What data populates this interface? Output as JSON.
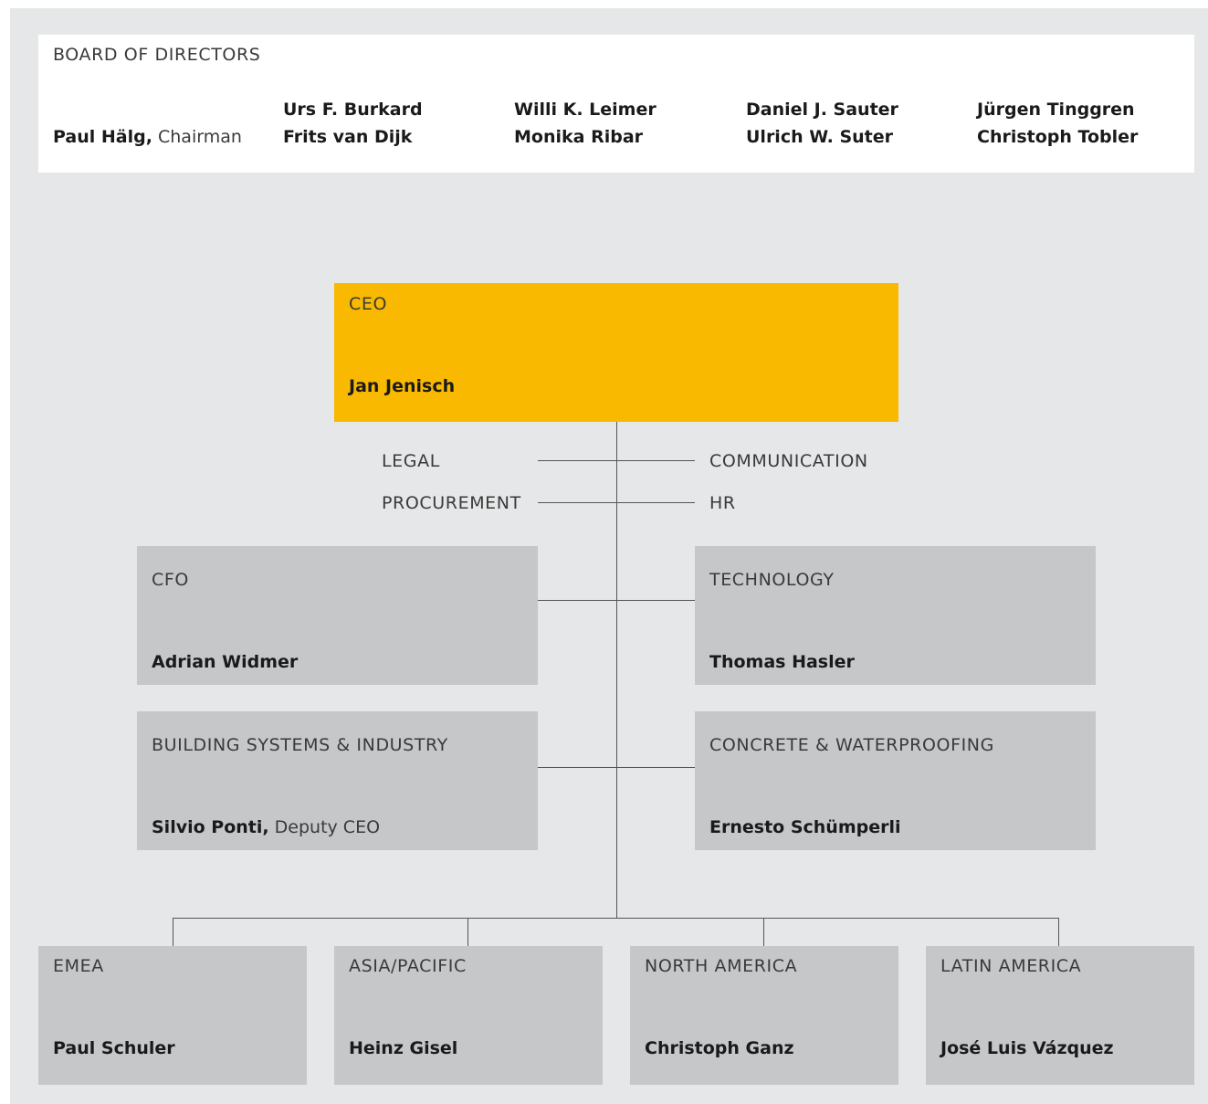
{
  "board": {
    "title": "BOARD OF DIRECTORS",
    "chairman_name": "Paul Hälg,",
    "chairman_role": "Chairman",
    "members": [
      [
        "Urs F. Burkard",
        "Frits van Dijk"
      ],
      [
        "Willi K. Leimer",
        "Monika Ribar"
      ],
      [
        "Daniel J. Sauter",
        "Ulrich W. Suter"
      ],
      [
        "Jürgen Tinggren",
        "Christoph Tobler"
      ]
    ]
  },
  "ceo": {
    "label": "CEO",
    "name": "Jan Jenisch"
  },
  "staff": {
    "legal": "LEGAL",
    "procurement": "PROCUREMENT",
    "communication": "COMMUNICATION",
    "hr": "HR"
  },
  "cfo": {
    "label": "CFO",
    "name": "Adrian Widmer"
  },
  "technology": {
    "label": "TECHNOLOGY",
    "name": "Thomas Hasler"
  },
  "building": {
    "label": "BUILDING SYSTEMS & INDUSTRY",
    "name": "Silvio Ponti,",
    "role": "Deputy CEO"
  },
  "concrete": {
    "label": "CONCRETE & WATERPROOFING",
    "name": "Ernesto Schümperli"
  },
  "regions": [
    {
      "label": "EMEA",
      "name": "Paul Schuler"
    },
    {
      "label": "ASIA/PACIFIC",
      "name": "Heinz Gisel"
    },
    {
      "label": "NORTH AMERICA",
      "name": "Christoph Ganz"
    },
    {
      "label": "LATIN AMERICA",
      "name": "José Luis Vázquez"
    }
  ],
  "colors": {
    "background": "#e6e7e8",
    "box": "#c6c7c9",
    "ceo": "#f9b900",
    "line": "#555555"
  }
}
